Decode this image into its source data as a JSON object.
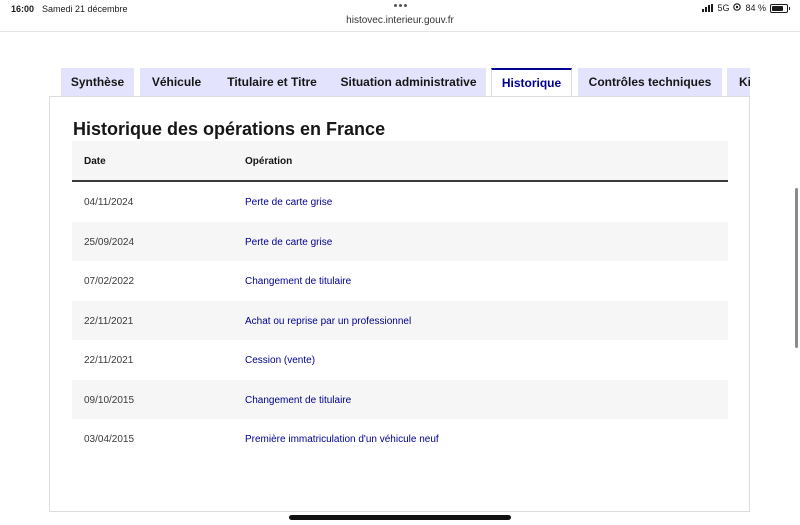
{
  "statusbar": {
    "time": "16:00",
    "date": "Samedi 21 décembre",
    "network": "5G",
    "battery": "84 %",
    "battery_level": 0.84
  },
  "browser": {
    "url": "histovec.interieur.gouv.fr"
  },
  "tabs": [
    {
      "label": "Synthèse",
      "active": false
    },
    {
      "label": "Véhicule",
      "active": false
    },
    {
      "label": "Titulaire et Titre",
      "active": false
    },
    {
      "label": "Situation administrative",
      "active": false
    },
    {
      "label": "Historique",
      "active": true
    },
    {
      "label": "Contrôles techniques",
      "active": false
    },
    {
      "label": "Kilo",
      "active": false
    }
  ],
  "section": {
    "title": "Historique des opérations en France",
    "columns": {
      "date": "Date",
      "operation": "Opération"
    },
    "rows": [
      {
        "date": "04/11/2024",
        "operation": "Perte de carte grise"
      },
      {
        "date": "25/09/2024",
        "operation": "Perte de carte grise"
      },
      {
        "date": "07/02/2022",
        "operation": "Changement de titulaire"
      },
      {
        "date": "22/11/2021",
        "operation": "Achat ou reprise par un professionnel"
      },
      {
        "date": "22/11/2021",
        "operation": "Cession (vente)"
      },
      {
        "date": "09/10/2015",
        "operation": "Changement de titulaire"
      },
      {
        "date": "03/04/2015",
        "operation": "Première immatriculation d'un véhicule neuf"
      }
    ]
  },
  "colors": {
    "accent": "#000091",
    "tab_bg": "#e3e3fd",
    "row_alt": "#f6f6f6"
  }
}
